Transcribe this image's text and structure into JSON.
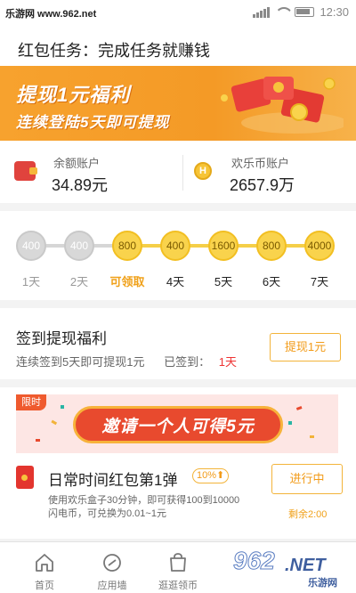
{
  "status_bar": {
    "watermark": "乐游网 www.962.net",
    "time": "12:30"
  },
  "header": {
    "title": "红包任务：完成任务就赚钱"
  },
  "banner": {
    "line1": "提现1元福利",
    "line2": "连续登陆5天即可提现"
  },
  "accounts": {
    "balance": {
      "label": "余额账户",
      "value": "34.89元",
      "icon": "wallet-icon"
    },
    "coins": {
      "label": "欢乐币账户",
      "value": "2657.9万",
      "icon_text": "H"
    }
  },
  "checkin": {
    "days": [
      {
        "amount": "400",
        "label": "1天",
        "state": "done"
      },
      {
        "amount": "400",
        "label": "2天",
        "state": "done"
      },
      {
        "amount": "800",
        "label": "可领取",
        "state": "claim"
      },
      {
        "amount": "400",
        "label": "4天",
        "state": "future"
      },
      {
        "amount": "1600",
        "label": "5天",
        "state": "future"
      },
      {
        "amount": "800",
        "label": "6天",
        "state": "future"
      },
      {
        "amount": "4000",
        "label": "7天",
        "state": "future"
      }
    ]
  },
  "signin": {
    "title": "签到提现福利",
    "desc": "连续签到5天即可提现1元",
    "done_label": "已签到：",
    "done_value": "1天",
    "button": "提现1元"
  },
  "invite": {
    "tag": "限时",
    "text": "邀请一个人可得5元"
  },
  "task": {
    "name": "日常时间红包第1弹",
    "chip": "10%⬆",
    "desc_line1": "使用欢乐盒子30分钟，即可获得100到10000",
    "desc_line2": "闪电币，可兑换为0.01~1元",
    "button": "进行中",
    "remain": "剩余2:00"
  },
  "nav": {
    "items": [
      {
        "label": "首页",
        "icon": "home-icon"
      },
      {
        "label": "应用墙",
        "icon": "app-wall-icon"
      },
      {
        "label": "逛逛领币",
        "icon": "shopping-bag-icon"
      }
    ],
    "watermark_big": "962",
    "watermark_net": ".NET",
    "watermark_cn": "乐游网"
  },
  "colors": {
    "accent": "#f29b18",
    "banner": "#f49a26",
    "red": "#e33333"
  }
}
